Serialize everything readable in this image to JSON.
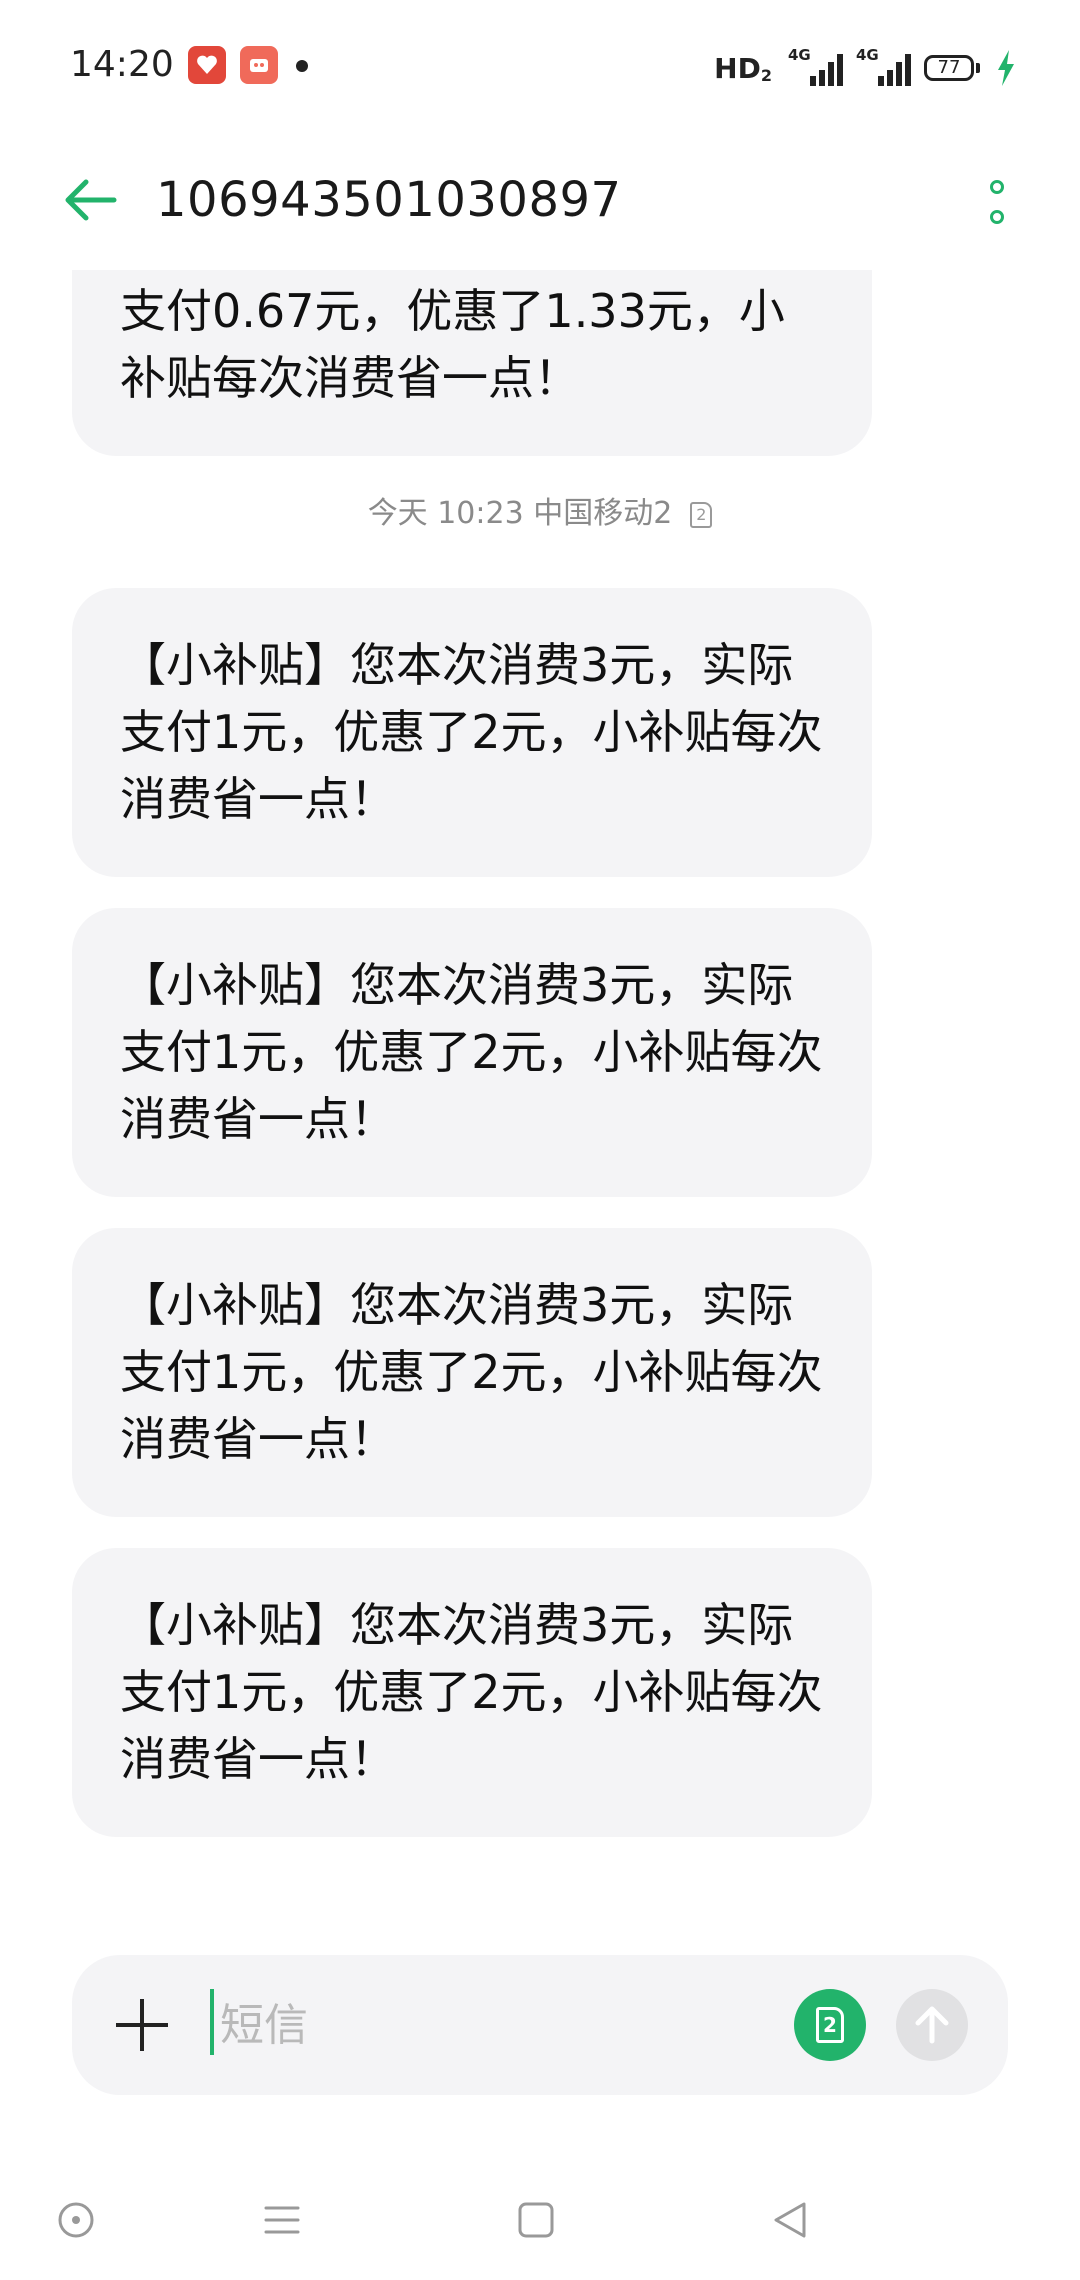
{
  "status_bar": {
    "time": "14:20",
    "hd": "HD",
    "hd_sub": "2",
    "network_1": "4G",
    "network_2": "4G",
    "battery": "77"
  },
  "header": {
    "title": "106943501030897"
  },
  "messages": {
    "partial_text": "支付0.67元，优惠了1.33元，小补贴每次消费省一点！",
    "timestamp": "今天 10:23  中国移动2",
    "sim_number": "2",
    "items": [
      "【小补贴】您本次消费3元，实际支付1元，优惠了2元，小补贴每次消费省一点！",
      "【小补贴】您本次消费3元，实际支付1元，优惠了2元，小补贴每次消费省一点！",
      "【小补贴】您本次消费3元，实际支付1元，优惠了2元，小补贴每次消费省一点！",
      "【小补贴】您本次消费3元，实际支付1元，优惠了2元，小补贴每次消费省一点！"
    ]
  },
  "input_bar": {
    "placeholder": "短信",
    "sim_label": "2"
  },
  "colors": {
    "accent": "#22b36b",
    "bubble": "#f4f4f6"
  }
}
